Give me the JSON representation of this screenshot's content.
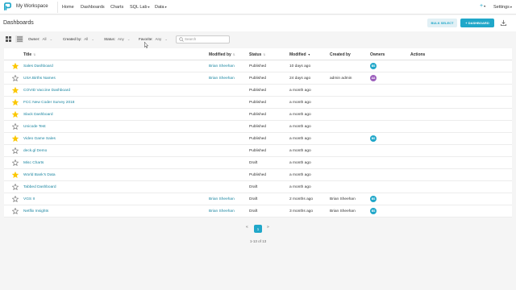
{
  "topnav": {
    "workspace": "My Workspace",
    "links": [
      {
        "label": "Home",
        "dropdown": false
      },
      {
        "label": "Dashboards",
        "dropdown": false
      },
      {
        "label": "Charts",
        "dropdown": false
      },
      {
        "label": "SQL Lab",
        "dropdown": true
      },
      {
        "label": "Data",
        "dropdown": true
      }
    ],
    "plus_icon": "+",
    "settings_label": "Settings"
  },
  "header": {
    "title": "Dashboards",
    "bulk_select_label": "BULK SELECT",
    "add_dashboard_label": "+ DASHBOARD"
  },
  "filters": {
    "owner": {
      "label": "Owner:",
      "value": "All"
    },
    "created_by": {
      "label": "Created by:",
      "value": "All"
    },
    "status": {
      "label": "Status:",
      "value": "Any"
    },
    "favorite": {
      "label": "Favorite:",
      "value": "Any"
    },
    "search_placeholder": "Search"
  },
  "table": {
    "columns": [
      "Title",
      "Modified by",
      "Status",
      "Modified",
      "Created by",
      "Owners",
      "Actions"
    ],
    "rows": [
      {
        "favorite": true,
        "title": "Sales Dashboard",
        "modified_by": "Brian Sheehan",
        "status": "Published",
        "modified": "10 days ago",
        "created_by": "",
        "owner": {
          "initials": "BS",
          "color": "#20a7c9"
        }
      },
      {
        "favorite": false,
        "title": "USA Births Names",
        "modified_by": "Brian Sheehan",
        "status": "Published",
        "modified": "24 days ago",
        "created_by": "admin admin",
        "owner": {
          "initials": "AA",
          "color": "#9c5fbc"
        }
      },
      {
        "favorite": true,
        "title": "COVID Vaccine Dashboard",
        "modified_by": "",
        "status": "Published",
        "modified": "a month ago",
        "created_by": "",
        "owner": null
      },
      {
        "favorite": true,
        "title": "FCC New Coder Survey 2018",
        "modified_by": "",
        "status": "Published",
        "modified": "a month ago",
        "created_by": "",
        "owner": null
      },
      {
        "favorite": true,
        "title": "Slack Dashboard",
        "modified_by": "",
        "status": "Published",
        "modified": "a month ago",
        "created_by": "",
        "owner": null
      },
      {
        "favorite": false,
        "title": "Unicode Test",
        "modified_by": "",
        "status": "Published",
        "modified": "a month ago",
        "created_by": "",
        "owner": null
      },
      {
        "favorite": true,
        "title": "Video Game Sales",
        "modified_by": "",
        "status": "Published",
        "modified": "a month ago",
        "created_by": "",
        "owner": {
          "initials": "BS",
          "color": "#20a7c9"
        }
      },
      {
        "favorite": false,
        "title": "deck.gl Demo",
        "modified_by": "",
        "status": "Published",
        "modified": "a month ago",
        "created_by": "",
        "owner": null
      },
      {
        "favorite": false,
        "title": "Misc Charts",
        "modified_by": "",
        "status": "Draft",
        "modified": "a month ago",
        "created_by": "",
        "owner": null
      },
      {
        "favorite": true,
        "title": "World Bank's Data",
        "modified_by": "",
        "status": "Published",
        "modified": "a month ago",
        "created_by": "",
        "owner": null
      },
      {
        "favorite": false,
        "title": "Tabbed Dashboard",
        "modified_by": "",
        "status": "Draft",
        "modified": "a month ago",
        "created_by": "",
        "owner": null
      },
      {
        "favorite": false,
        "title": "VGS II",
        "modified_by": "Brian Sheehan",
        "status": "Draft",
        "modified": "2 months ago",
        "created_by": "Brian Sheehan",
        "owner": {
          "initials": "BS",
          "color": "#20a7c9"
        }
      },
      {
        "favorite": false,
        "title": "Netflix Insights",
        "modified_by": "Brian Sheehan",
        "status": "Draft",
        "modified": "3 months ago",
        "created_by": "Brian Sheehan",
        "owner": {
          "initials": "BS",
          "color": "#20a7c9"
        }
      }
    ]
  },
  "pagination": {
    "prev": "«",
    "current": "1",
    "next": "»",
    "summary": "1-13 of 13"
  },
  "colors": {
    "accent": "#20a7c9",
    "link": "#1a85a0",
    "star_active": "#fbc700",
    "star_inactive": "#666666"
  }
}
